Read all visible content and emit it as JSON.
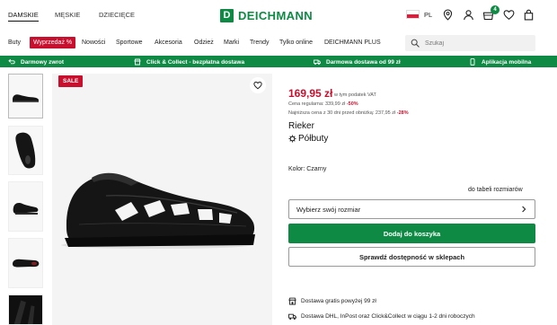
{
  "header": {
    "genders": [
      "DAMSKIE",
      "MĘSKIE",
      "DZIECIĘCE"
    ],
    "logo_letter": "D",
    "logo_text": "DEICHMANN",
    "language": "PL",
    "cart_count": "4",
    "icons": [
      "store-locator-icon",
      "account-icon",
      "cart-icon",
      "wishlist-icon",
      "bag-icon"
    ]
  },
  "nav": {
    "items": [
      "Buty",
      "Wyprzedaż %",
      "Nowości",
      "Sportowe",
      "Akcesoria",
      "Odzież",
      "Marki",
      "Trendy",
      "Tylko online",
      "DEICHMANN PLUS"
    ],
    "search_placeholder": "Szukaj"
  },
  "promo": {
    "items": [
      "Darmowy zwrot",
      "Click & Collect - bezpłatna dostawa",
      "Darmowa dostawa od 99 zł",
      "Aplikacja mobilna"
    ]
  },
  "gallery": {
    "sale_label": "SALE"
  },
  "product": {
    "price": "169,95 zł",
    "vat_note": "w tym podatek VAT",
    "regular_price_label": "Cena regularna: 339,99 zł",
    "regular_discount": "-50%",
    "lowest_price_label": "Najniższa cena z 30 dni przed obniżką: 237,95 zł",
    "lowest_discount": "-28%",
    "brand": "Rieker",
    "type": "Półbuty",
    "color_line": "Kolor: Czarny",
    "size_table_link": "do tabeli rozmiarów",
    "size_select": "Wybierz swój rozmiar",
    "add_to_cart": "Dodaj do koszyka",
    "check_store": "Sprawdź dostępność w sklepach"
  },
  "shipping": {
    "free_delivery": "Dostawa gratis powyżej 99 zł",
    "carriers": "Dostawa DHL, InPost oraz Click&Collect w ciągu 1-2 dni roboczych"
  },
  "colors": {
    "brand_green": "#0e8a44",
    "sale_red": "#c8102e"
  }
}
